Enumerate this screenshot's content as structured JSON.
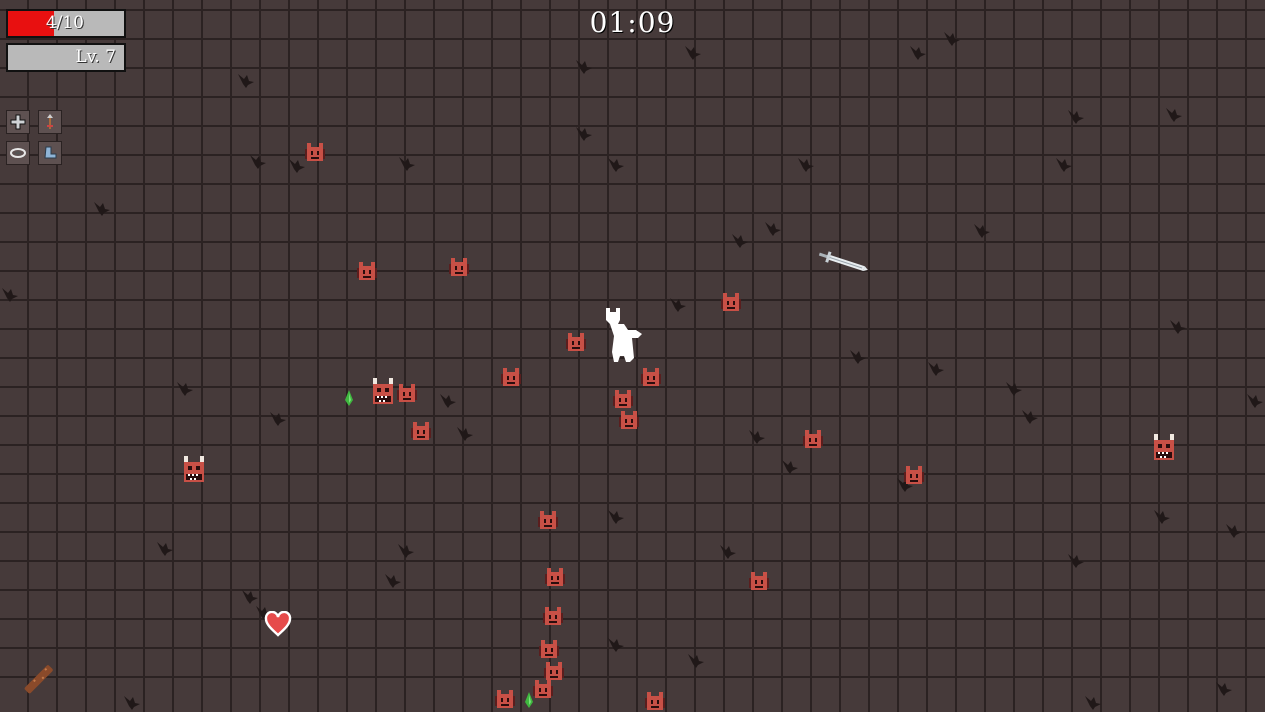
{
  "hud": {
    "health_text": "4/10",
    "health_fraction": 0.4,
    "level_text": "Lv. 7",
    "timer": "01:09"
  },
  "colors": {
    "health_fill": "#e81010",
    "bar_bg": "#b9b9b9",
    "floor": "#463a3a",
    "grid": "#2b2222",
    "enemy": "#c85046"
  },
  "abilities": [
    {
      "icon": "cross-arrows-icon"
    },
    {
      "icon": "arrow-up-icon"
    },
    {
      "icon": "halo-ring-icon"
    },
    {
      "icon": "wing-boot-icon"
    }
  ],
  "pickups": [
    {
      "type": "heart-pickup"
    },
    {
      "type": "xp-gem-green"
    }
  ]
}
